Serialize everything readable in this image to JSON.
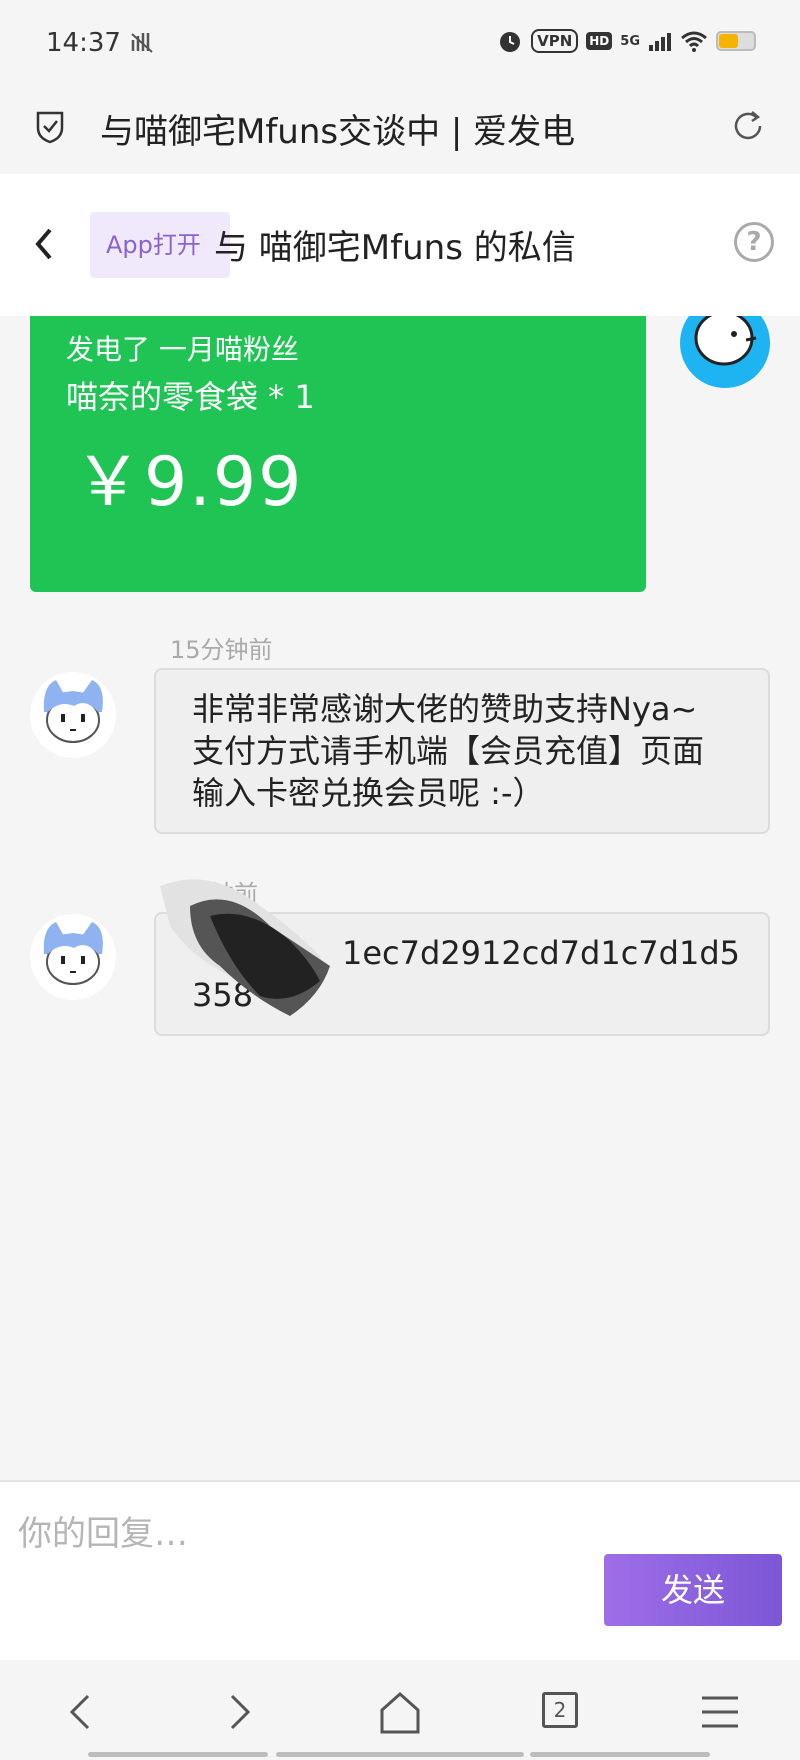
{
  "status_bar": {
    "time": "14:37",
    "vpn_label": "VPN",
    "hd_label": "HD",
    "network_label": "5G",
    "battery_level": 0.55
  },
  "browser": {
    "title": "与喵御宅Mfuns交谈中 | 爱发电"
  },
  "header": {
    "app_open_label": "App打开",
    "title": "与 喵御宅Mfuns 的私信",
    "help_glyph": "?"
  },
  "sponsor_card": {
    "line1": "发电了 一月喵粉丝",
    "line2": "喵奈的零食袋 * 1",
    "price": "￥9.99"
  },
  "messages": [
    {
      "time": "15分钟前",
      "text": "非常非常感谢大佬的赞助支持Nya~ 支付方式请手机端【会员充值】页面输入卡密兑换会员呢 :-）"
    },
    {
      "time": "钟前",
      "text": "1ec7d2912cd7d1c7d1d5",
      "text_line2": "358"
    }
  ],
  "reply": {
    "placeholder": "你的回复…",
    "send_label": "发送"
  },
  "bottom_nav": {
    "tab_count": "2"
  },
  "colors": {
    "accent": "#8a63d2",
    "sponsor_green": "#1fc455",
    "send_button": "#7c57d6"
  }
}
